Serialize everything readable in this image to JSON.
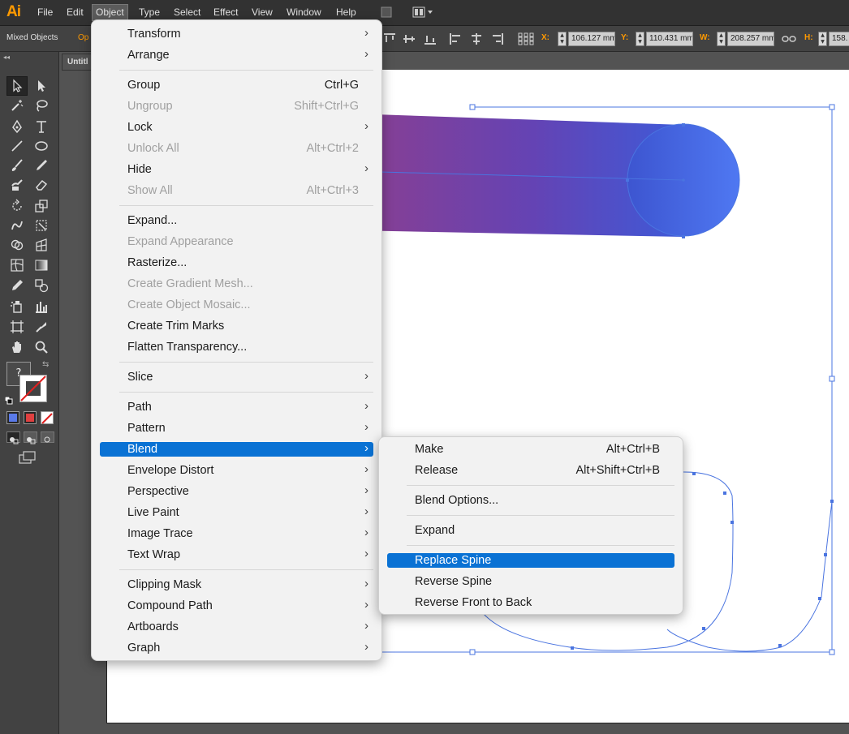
{
  "menubar": {
    "logo": "Ai",
    "items": [
      "File",
      "Edit",
      "Object",
      "Type",
      "Select",
      "Effect",
      "View",
      "Window",
      "Help"
    ]
  },
  "controlbar": {
    "selection": "Mixed Objects",
    "opacity_stub": "Op",
    "x_label": "X:",
    "x_value": "106.127 mm",
    "y_label": "Y:",
    "y_value": "110.431 mm",
    "w_label": "W:",
    "w_value": "208.257 mm",
    "h_label": "H:",
    "h_value": "158."
  },
  "document": {
    "tab_title": "Untitl"
  },
  "toolpanel": {
    "color_question_mark": "?"
  },
  "object_menu": {
    "items": [
      {
        "label": "Transform",
        "shortcut": "",
        "submenu": true,
        "disabled": false
      },
      {
        "label": "Arrange",
        "shortcut": "",
        "submenu": true,
        "disabled": false
      },
      {
        "label": "Group",
        "shortcut": "Ctrl+G",
        "submenu": false,
        "disabled": false
      },
      {
        "label": "Ungroup",
        "shortcut": "Shift+Ctrl+G",
        "submenu": false,
        "disabled": true
      },
      {
        "label": "Lock",
        "shortcut": "",
        "submenu": true,
        "disabled": false
      },
      {
        "label": "Unlock All",
        "shortcut": "Alt+Ctrl+2",
        "submenu": false,
        "disabled": true
      },
      {
        "label": "Hide",
        "shortcut": "",
        "submenu": true,
        "disabled": false
      },
      {
        "label": "Show All",
        "shortcut": "Alt+Ctrl+3",
        "submenu": false,
        "disabled": true
      },
      {
        "label": "Expand...",
        "shortcut": "",
        "submenu": false,
        "disabled": false
      },
      {
        "label": "Expand Appearance",
        "shortcut": "",
        "submenu": false,
        "disabled": true
      },
      {
        "label": "Rasterize...",
        "shortcut": "",
        "submenu": false,
        "disabled": false
      },
      {
        "label": "Create Gradient Mesh...",
        "shortcut": "",
        "submenu": false,
        "disabled": true
      },
      {
        "label": "Create Object Mosaic...",
        "shortcut": "",
        "submenu": false,
        "disabled": true
      },
      {
        "label": "Create Trim Marks",
        "shortcut": "",
        "submenu": false,
        "disabled": false
      },
      {
        "label": "Flatten Transparency...",
        "shortcut": "",
        "submenu": false,
        "disabled": false
      },
      {
        "label": "Slice",
        "shortcut": "",
        "submenu": true,
        "disabled": false
      },
      {
        "label": "Path",
        "shortcut": "",
        "submenu": true,
        "disabled": false
      },
      {
        "label": "Pattern",
        "shortcut": "",
        "submenu": true,
        "disabled": false
      },
      {
        "label": "Blend",
        "shortcut": "",
        "submenu": true,
        "disabled": false
      },
      {
        "label": "Envelope Distort",
        "shortcut": "",
        "submenu": true,
        "disabled": false
      },
      {
        "label": "Perspective",
        "shortcut": "",
        "submenu": true,
        "disabled": false
      },
      {
        "label": "Live Paint",
        "shortcut": "",
        "submenu": true,
        "disabled": false
      },
      {
        "label": "Image Trace",
        "shortcut": "",
        "submenu": true,
        "disabled": false
      },
      {
        "label": "Text Wrap",
        "shortcut": "",
        "submenu": true,
        "disabled": false
      },
      {
        "label": "Clipping Mask",
        "shortcut": "",
        "submenu": true,
        "disabled": false
      },
      {
        "label": "Compound Path",
        "shortcut": "",
        "submenu": true,
        "disabled": false
      },
      {
        "label": "Artboards",
        "shortcut": "",
        "submenu": true,
        "disabled": false
      },
      {
        "label": "Graph",
        "shortcut": "",
        "submenu": true,
        "disabled": false
      }
    ]
  },
  "blend_submenu": {
    "items": [
      {
        "label": "Make",
        "shortcut": "Alt+Ctrl+B"
      },
      {
        "label": "Release",
        "shortcut": "Alt+Shift+Ctrl+B"
      },
      {
        "label": "Blend Options...",
        "shortcut": ""
      },
      {
        "label": "Expand",
        "shortcut": ""
      },
      {
        "label": "Replace Spine",
        "shortcut": ""
      },
      {
        "label": "Reverse Spine",
        "shortcut": ""
      },
      {
        "label": "Reverse Front to Back",
        "shortcut": ""
      }
    ]
  },
  "colors": {
    "menu_highlight": "#0a72d4",
    "app_accent": "#ff9a00",
    "selection_blue": "#4a74e0",
    "gradient_start": "#8b3f90",
    "gradient_end": "#4a6ff0"
  }
}
